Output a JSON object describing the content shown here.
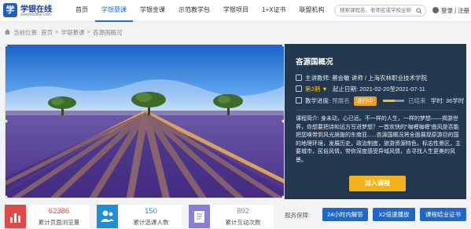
{
  "header": {
    "logo_name": "学银在线",
    "logo_url": "xueyinonline.com",
    "nav": [
      "首页",
      "学银慕课",
      "学银金课",
      "示范教学包",
      "学银项目",
      "1+X证书",
      "联盟机构"
    ],
    "active_nav_index": 1,
    "search_placeholder": "搜索课程名、老师名或学校全称",
    "login_label": "登录",
    "register_label": "注册",
    "separator": "|"
  },
  "breadcrumb": {
    "prefix": "当前位置:",
    "items": [
      "首页",
      "学银慕课",
      "吝源国概况"
    ],
    "separator": ">"
  },
  "course": {
    "title": "吝源国概况",
    "teacher_label": "主讲教师:",
    "teacher": "蔡会敏 讲师 / 上海农林职业技术学院",
    "term_label": "第2期",
    "term_arrow": "▼",
    "date_label": "起止日期:",
    "dates": "2021-02-20至2021-07-11",
    "progress_label": "教学进度:",
    "progress_start": "预展名",
    "progress_fraction": 0.55,
    "status": "进行中",
    "progress_end": "已结束",
    "hours_label": "学时:",
    "hours": "36学时",
    "intro": "课程简介: 身未动，心已远。不一样的人生，一样的梦想——揭游世界，你想要把诗和远方写进梦想？一首欢快的“咖喱咖喱”曲风是否能把您唤带到风光旖旎的东南亚......吝源国概况将全面展现原游目的国的地理环境，发展历史，政治制度，旅游资源特色，标志性景区，主要城市，民俗风情，带你深度感受异域风情，去寻找人生更美的风景。",
    "join_button": "加入课程"
  },
  "stats": [
    {
      "value": "62386",
      "label": "累计页面浏览量",
      "color": "#e04a4a"
    },
    {
      "value": "150",
      "label": "累计选课人数",
      "color": "#1e8fd6"
    },
    {
      "value": "892",
      "label": "累计互动次数",
      "color": "#8a7fd3"
    }
  ],
  "services": {
    "label": "服务保障:",
    "items": [
      "24小时内解答",
      "X2倍速播放",
      "课程结业证书"
    ]
  }
}
